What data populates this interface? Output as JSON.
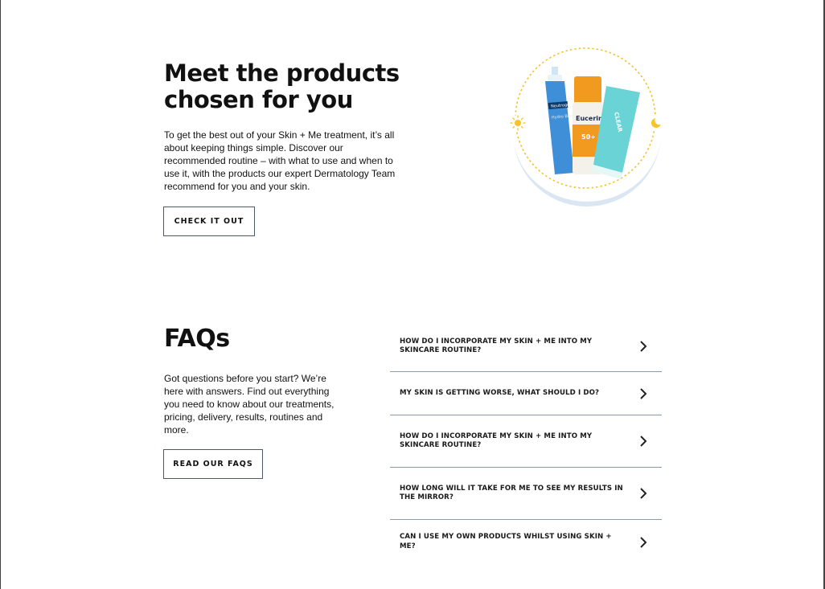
{
  "products": {
    "title": "Meet the products chosen for you",
    "description": "To get the best out of your Skin + Me treatment, it’s all about keeping things simple. Discover our recommended routine – with what to use and when to use it, with the products our expert Dermatology Team recommend for you and your skin.",
    "button_label": "CHECK IT OUT",
    "bottle_brand": "Neutrogena",
    "bottle_text": "Hydro Boost",
    "sunscreen_brand": "Eucerin",
    "sunscreen_spf": "50+",
    "tube_brand": "CLEAR",
    "icons": [
      "sun-icon",
      "moon-icon"
    ],
    "colors": {
      "ring": "#f2c230",
      "arc": "#dbe6f3",
      "bottle": "#3f8fd8",
      "sunscreen": "#f29a1f",
      "tube": "#6ad3d6"
    }
  },
  "faqs": {
    "title": "FAQs",
    "description": "Got questions before you start? We’re here with answers. Find out everything you need to know about our treatments, pricing, delivery, results, routines and more.",
    "button_label": "READ OUR FAQS",
    "items": [
      {
        "question": "HOW DO I INCORPORATE MY SKIN + ME INTO MY SKINCARE ROUTINE?"
      },
      {
        "question": "MY SKIN IS GETTING WORSE, WHAT SHOULD I DO?"
      },
      {
        "question": "HOW DO I INCORPORATE MY SKIN + ME INTO MY SKINCARE ROUTINE?"
      },
      {
        "question": "HOW LONG WILL IT TAKE FOR ME TO SEE MY RESULTS IN THE MIRROR?"
      },
      {
        "question": "CAN I USE MY OWN PRODUCTS WHILST USING SKIN + ME?"
      }
    ],
    "chevron_icon": "chevron-right-icon"
  }
}
